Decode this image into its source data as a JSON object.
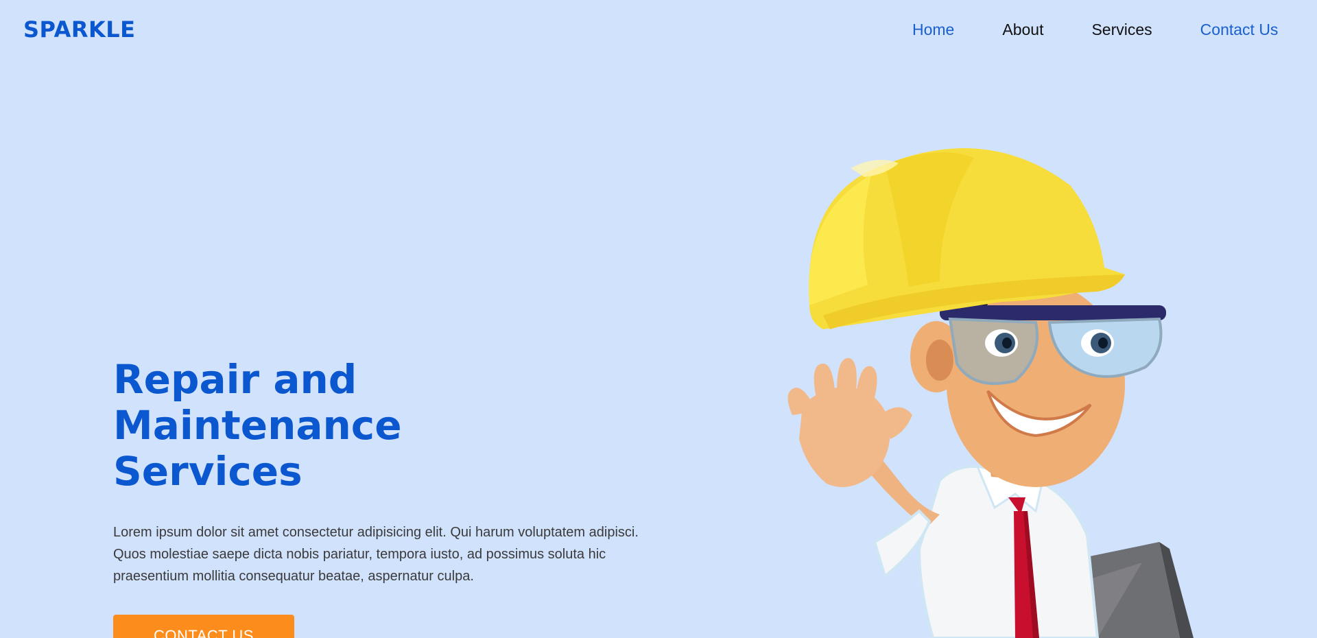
{
  "brand": {
    "name": "SPARKLE",
    "accent_color": "#0b57d0",
    "background_color": "#d1e2fd"
  },
  "nav": {
    "items": [
      {
        "label": "Home",
        "state": "active"
      },
      {
        "label": "About",
        "state": "default"
      },
      {
        "label": "Services",
        "state": "default"
      },
      {
        "label": "Contact Us",
        "state": "highlight"
      }
    ]
  },
  "hero": {
    "title_lines": [
      "Repair and",
      "Maintenance",
      "Services"
    ],
    "description": "Lorem ipsum dolor sit amet consectetur adipisicing elit. Qui harum voluptatem adipisci. Quos molestiae saepe dicta nobis pariatur, tempora iusto, ad possimus soluta hic praesentium mollitia consequatur beatae, aspernatur culpa.",
    "cta_label": "CONTACT US",
    "cta_color": "#fc8d1c"
  },
  "illustration": {
    "icon": "worker-hardhat-waving-icon"
  }
}
